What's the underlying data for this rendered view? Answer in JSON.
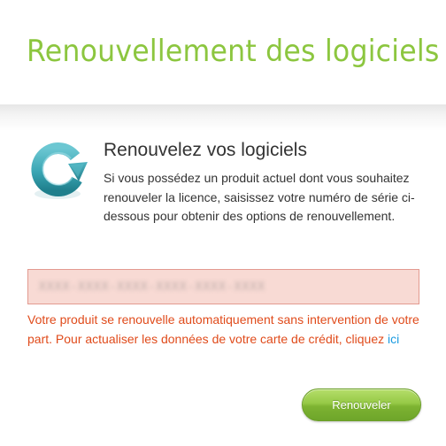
{
  "header": {
    "title": "Renouvellement des logiciels"
  },
  "section": {
    "icon": "renew-refresh-icon",
    "title": "Renouvelez vos logiciels",
    "description": "Si vous possédez un produit actuel dont vous souhaitez renouveler la licence, saisissez votre numéro de série ci-dessous pour obtenir des options de renouvellement."
  },
  "serial_field": {
    "value": "XXXX-XXXX-XXXX-XXXX-XXXX-XXXX"
  },
  "error": {
    "text": "Votre produit se renouvelle automatiquement sans intervention de votre part. Pour actualiser les données de votre carte de crédit, cliquez ",
    "link_label": "ici"
  },
  "actions": {
    "renew_label": "Renouveler"
  },
  "colors": {
    "title_green": "#8cc63f",
    "error_red": "#e04b1b",
    "link_blue": "#1a9be0",
    "field_bg": "#f8dad4",
    "button_green": "#7db332",
    "icon_teal": "#3aa6b4"
  }
}
